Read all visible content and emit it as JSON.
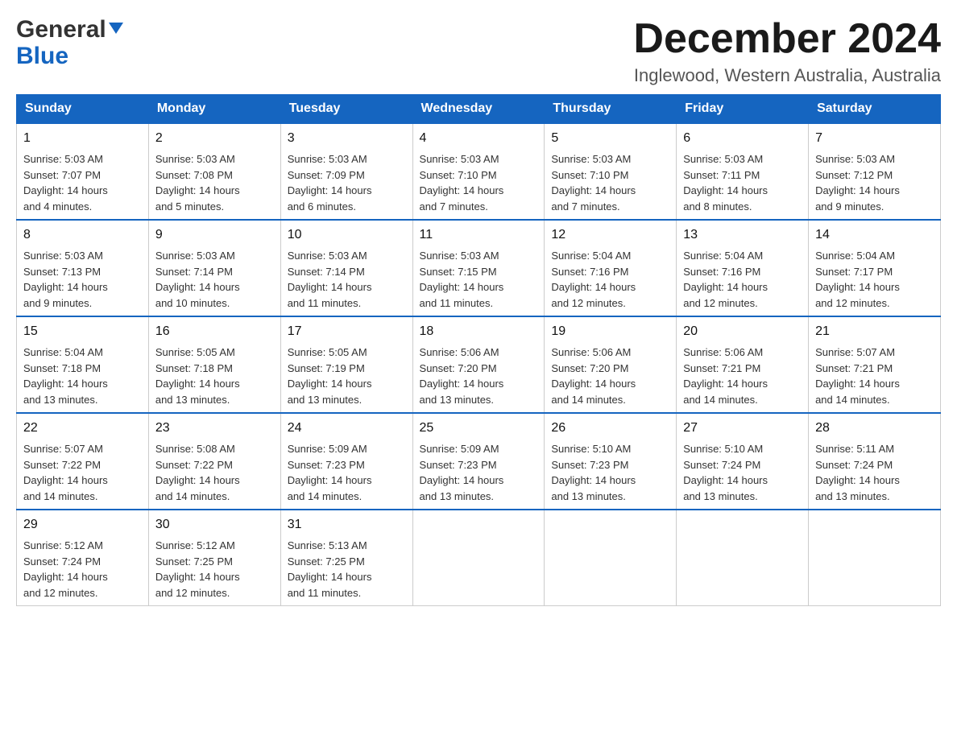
{
  "logo": {
    "general": "General",
    "blue": "Blue",
    "arrow": "▼"
  },
  "header": {
    "month_title": "December 2024",
    "location": "Inglewood, Western Australia, Australia"
  },
  "days_of_week": [
    "Sunday",
    "Monday",
    "Tuesday",
    "Wednesday",
    "Thursday",
    "Friday",
    "Saturday"
  ],
  "weeks": [
    [
      {
        "day": "1",
        "sunrise": "5:03 AM",
        "sunset": "7:07 PM",
        "daylight": "14 hours and 4 minutes."
      },
      {
        "day": "2",
        "sunrise": "5:03 AM",
        "sunset": "7:08 PM",
        "daylight": "14 hours and 5 minutes."
      },
      {
        "day": "3",
        "sunrise": "5:03 AM",
        "sunset": "7:09 PM",
        "daylight": "14 hours and 6 minutes."
      },
      {
        "day": "4",
        "sunrise": "5:03 AM",
        "sunset": "7:10 PM",
        "daylight": "14 hours and 7 minutes."
      },
      {
        "day": "5",
        "sunrise": "5:03 AM",
        "sunset": "7:10 PM",
        "daylight": "14 hours and 7 minutes."
      },
      {
        "day": "6",
        "sunrise": "5:03 AM",
        "sunset": "7:11 PM",
        "daylight": "14 hours and 8 minutes."
      },
      {
        "day": "7",
        "sunrise": "5:03 AM",
        "sunset": "7:12 PM",
        "daylight": "14 hours and 9 minutes."
      }
    ],
    [
      {
        "day": "8",
        "sunrise": "5:03 AM",
        "sunset": "7:13 PM",
        "daylight": "14 hours and 9 minutes."
      },
      {
        "day": "9",
        "sunrise": "5:03 AM",
        "sunset": "7:14 PM",
        "daylight": "14 hours and 10 minutes."
      },
      {
        "day": "10",
        "sunrise": "5:03 AM",
        "sunset": "7:14 PM",
        "daylight": "14 hours and 11 minutes."
      },
      {
        "day": "11",
        "sunrise": "5:03 AM",
        "sunset": "7:15 PM",
        "daylight": "14 hours and 11 minutes."
      },
      {
        "day": "12",
        "sunrise": "5:04 AM",
        "sunset": "7:16 PM",
        "daylight": "14 hours and 12 minutes."
      },
      {
        "day": "13",
        "sunrise": "5:04 AM",
        "sunset": "7:16 PM",
        "daylight": "14 hours and 12 minutes."
      },
      {
        "day": "14",
        "sunrise": "5:04 AM",
        "sunset": "7:17 PM",
        "daylight": "14 hours and 12 minutes."
      }
    ],
    [
      {
        "day": "15",
        "sunrise": "5:04 AM",
        "sunset": "7:18 PM",
        "daylight": "14 hours and 13 minutes."
      },
      {
        "day": "16",
        "sunrise": "5:05 AM",
        "sunset": "7:18 PM",
        "daylight": "14 hours and 13 minutes."
      },
      {
        "day": "17",
        "sunrise": "5:05 AM",
        "sunset": "7:19 PM",
        "daylight": "14 hours and 13 minutes."
      },
      {
        "day": "18",
        "sunrise": "5:06 AM",
        "sunset": "7:20 PM",
        "daylight": "14 hours and 13 minutes."
      },
      {
        "day": "19",
        "sunrise": "5:06 AM",
        "sunset": "7:20 PM",
        "daylight": "14 hours and 14 minutes."
      },
      {
        "day": "20",
        "sunrise": "5:06 AM",
        "sunset": "7:21 PM",
        "daylight": "14 hours and 14 minutes."
      },
      {
        "day": "21",
        "sunrise": "5:07 AM",
        "sunset": "7:21 PM",
        "daylight": "14 hours and 14 minutes."
      }
    ],
    [
      {
        "day": "22",
        "sunrise": "5:07 AM",
        "sunset": "7:22 PM",
        "daylight": "14 hours and 14 minutes."
      },
      {
        "day": "23",
        "sunrise": "5:08 AM",
        "sunset": "7:22 PM",
        "daylight": "14 hours and 14 minutes."
      },
      {
        "day": "24",
        "sunrise": "5:09 AM",
        "sunset": "7:23 PM",
        "daylight": "14 hours and 14 minutes."
      },
      {
        "day": "25",
        "sunrise": "5:09 AM",
        "sunset": "7:23 PM",
        "daylight": "14 hours and 13 minutes."
      },
      {
        "day": "26",
        "sunrise": "5:10 AM",
        "sunset": "7:23 PM",
        "daylight": "14 hours and 13 minutes."
      },
      {
        "day": "27",
        "sunrise": "5:10 AM",
        "sunset": "7:24 PM",
        "daylight": "14 hours and 13 minutes."
      },
      {
        "day": "28",
        "sunrise": "5:11 AM",
        "sunset": "7:24 PM",
        "daylight": "14 hours and 13 minutes."
      }
    ],
    [
      {
        "day": "29",
        "sunrise": "5:12 AM",
        "sunset": "7:24 PM",
        "daylight": "14 hours and 12 minutes."
      },
      {
        "day": "30",
        "sunrise": "5:12 AM",
        "sunset": "7:25 PM",
        "daylight": "14 hours and 12 minutes."
      },
      {
        "day": "31",
        "sunrise": "5:13 AM",
        "sunset": "7:25 PM",
        "daylight": "14 hours and 11 minutes."
      },
      null,
      null,
      null,
      null
    ]
  ],
  "labels": {
    "sunrise": "Sunrise:",
    "sunset": "Sunset:",
    "daylight": "Daylight:"
  }
}
